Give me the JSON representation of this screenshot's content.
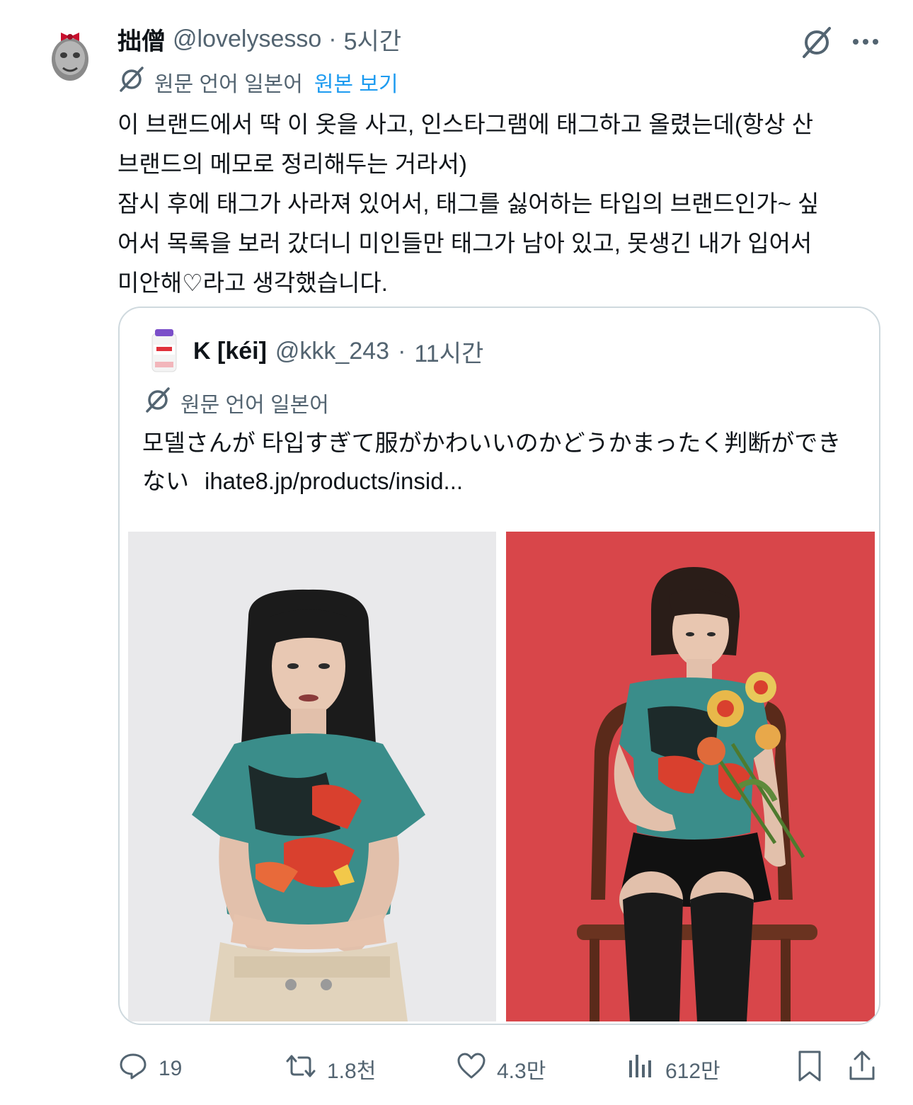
{
  "post": {
    "author_name": "拙僧",
    "handle": "@lovelysesso",
    "dot": "·",
    "time": "5시간",
    "translation": {
      "label": "원문 언어 일본어",
      "link": "원본 보기"
    },
    "lines": [
      "이 브랜드에서 딱 이 옷을 사고, 인스타그램에 태그하고 올렸는데(항상 산",
      "브랜드의 메모로 정리해두는 거라서)",
      "잠시 후에 태그가 사라져 있어서, 태그를 싫어하는 타입의 브랜드인가~ 싶",
      "어서 목록을 보러 갔더니 미인들만 태그가 남아 있고, 못생긴 내가 입어서",
      "미안해♡라고 생각했습니다."
    ]
  },
  "quote": {
    "author_name": "K [kéi]",
    "handle": "@kkk_243",
    "dot": "·",
    "time": "11시간",
    "translation_label": "원문 언어 일본어",
    "line1": "모델さんが 타입すぎて服がかわいいのかどうかまったく判断ができ",
    "line2": "ない",
    "link": "ihate8.jp/products/insid..."
  },
  "actions": {
    "replies": "19",
    "reposts": "1.8천",
    "likes": "4.3만",
    "views": "612만"
  },
  "colors": {
    "text": "#0f1419",
    "secondary": "#536471",
    "link": "#1d9bf0",
    "border": "#cfd9de"
  },
  "icons": [
    "grok-icon",
    "more-icon",
    "translate-icon",
    "reply-icon",
    "repost-icon",
    "like-icon",
    "views-icon",
    "bookmark-icon",
    "share-icon"
  ]
}
